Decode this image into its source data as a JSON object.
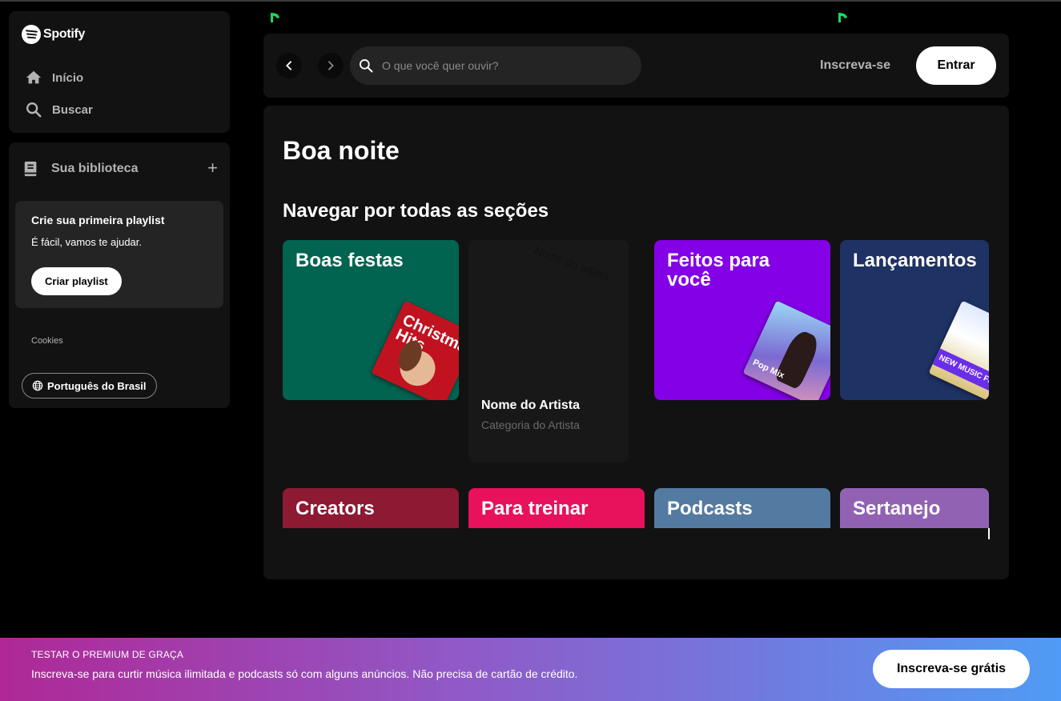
{
  "app": {
    "logo_text": "Spotify"
  },
  "sidebar": {
    "nav": [
      {
        "label": "Início",
        "icon": "home-icon"
      },
      {
        "label": "Buscar",
        "icon": "search-icon"
      }
    ],
    "library": {
      "title": "Sua biblioteca",
      "add_icon": "plus-icon",
      "promo": {
        "title": "Crie sua primeira playlist",
        "subtitle": "É fácil, vamos te ajudar.",
        "button": "Criar playlist"
      },
      "cookies": "Cookies",
      "language": "Português do Brasil"
    }
  },
  "topbar": {
    "search_placeholder": "O que você quer ouvir?",
    "signup": "Inscreva-se",
    "login": "Entrar"
  },
  "main": {
    "greeting": "Boa noite",
    "section_title": "Navegar por todas as seções",
    "tiles": [
      {
        "title": "Boas festas",
        "color": "#006450",
        "art_text": "Christmas Hits"
      },
      {
        "title": "Feitos para você",
        "color": "#8400e7",
        "art_text": "Pop Mix"
      },
      {
        "title": "Lançamentos",
        "color": "#1e3264",
        "art_text": "NEW MUSIC FRIDAY"
      }
    ],
    "artist_card": {
      "image_alt": "Nome do artista",
      "name": "Nome do Artista",
      "category": "Categoria do Artista"
    },
    "row2": [
      {
        "title": "Creators",
        "color": "#8d1932"
      },
      {
        "title": "Para treinar",
        "color": "#e8115b"
      },
      {
        "title": "Podcasts",
        "color": "#537aa1"
      },
      {
        "title": "Sertanejo",
        "color": "#9162b4"
      }
    ]
  },
  "banner": {
    "heading": "TESTAR O PREMIUM DE GRAÇA",
    "text": "Inscreva-se para curtir música ilimitada e podcasts só com alguns anúncios. Não precisa de cartão de crédito.",
    "button": "Inscreva-se grátis"
  }
}
